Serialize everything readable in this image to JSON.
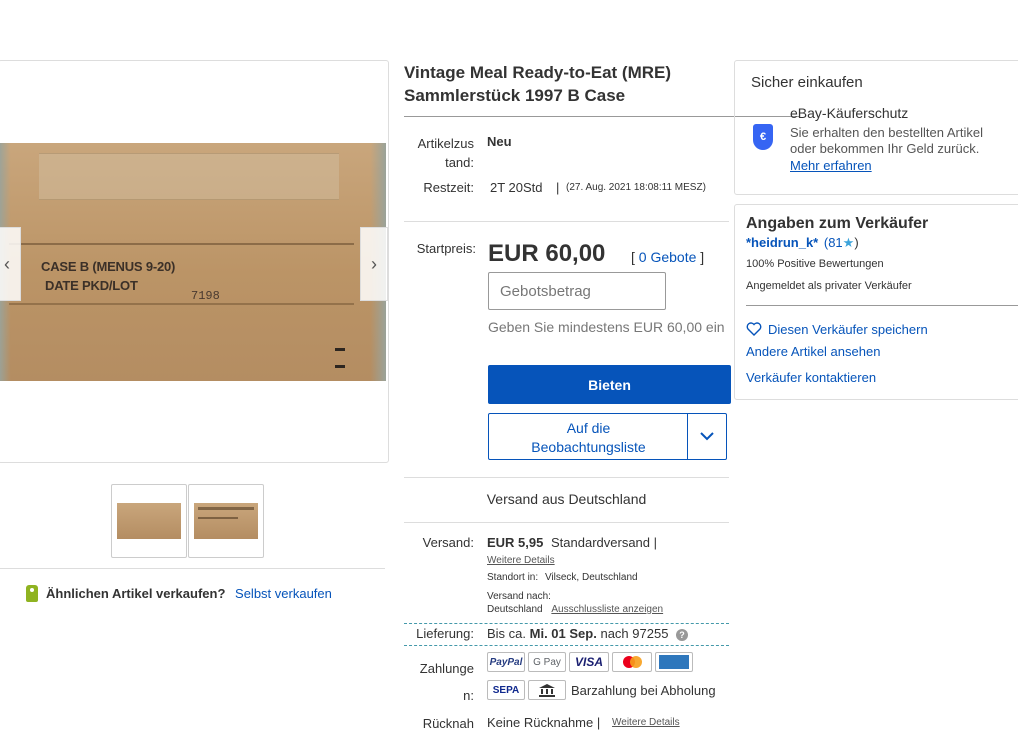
{
  "title": "Vintage Meal Ready-to-Eat (MRE) Sammlerstück 1997 B Case",
  "gallery": {
    "stencil_line1": "CASE B (MENUS 9-20)",
    "stencil_line2": "DATE PKD/LOT",
    "stencil_number": "7198",
    "arrow_left": "‹",
    "arrow_right": "›"
  },
  "sell_similar": {
    "question": "Ähnlichen Artikel verkaufen?",
    "link": "Selbst verkaufen"
  },
  "condition": {
    "label_line1": "Artikelzus",
    "label_line2": "tand:",
    "value": "Neu"
  },
  "time_left": {
    "label": "Restzeit:",
    "value": "2T 20Std",
    "separator": "|",
    "date": "(27. Aug. 2021   18:08:11 MESZ)"
  },
  "bid": {
    "label": "Startpreis:",
    "price": "EUR 60,00",
    "bids_open": "[",
    "bids_link": "0 Gebote",
    "bids_close": "]",
    "input_placeholder": "Gebotsbetrag",
    "hint": "Geben Sie mindestens EUR 60,00 ein",
    "button": "Bieten",
    "watch_line1": "Auf die",
    "watch_line2": "Beobachtungsliste"
  },
  "shipping_from": "Versand aus Deutschland",
  "shipping": {
    "label": "Versand:",
    "price": "EUR 5,95",
    "method": "Standardversand |",
    "details_link": "Weitere Details",
    "location_label": "Standort in:",
    "location": "Vilseck, Deutschland",
    "ship_to_label": "Versand nach:",
    "ship_to": "Deutschland",
    "exclusion_link": "Ausschlussliste anzeigen"
  },
  "delivery": {
    "label": "Lieferung:",
    "prefix": "Bis ca.",
    "date": "Mi. 01 Sep.",
    "suffix": "nach 97255",
    "help": "?"
  },
  "payment": {
    "label_line1": "Zahlunge",
    "label_line2": "n:",
    "methods": [
      "PayPal",
      "G Pay",
      "VISA",
      "Mastercard",
      "AMERICAN EXPRESS",
      "SEPA"
    ],
    "cash": "Barzahlung bei Abholung"
  },
  "returns": {
    "label": "Rücknah",
    "value": "Keine Rücknahme |",
    "link": "Weitere Details"
  },
  "protection": {
    "title": "Sicher einkaufen",
    "heading": "eBay-Käuferschutz",
    "text": "Sie erhalten den bestellten Artikel oder bekommen Ihr Geld zurück.",
    "link": "Mehr erfahren"
  },
  "seller": {
    "title": "Angaben zum Verkäufer",
    "name": "*heidrun_k*",
    "score": "(81",
    "score_close": ")",
    "positive": "100% Positive Bewertungen",
    "type": "Angemeldet als privater Verkäufer",
    "save": "Diesen Verkäufer speichern",
    "other_items": "Andere Artikel ansehen",
    "contact": "Verkäufer kontaktieren"
  },
  "colors": {
    "link": "#0654ba",
    "primary_button": "#0654ba",
    "star": "#3da4db"
  }
}
